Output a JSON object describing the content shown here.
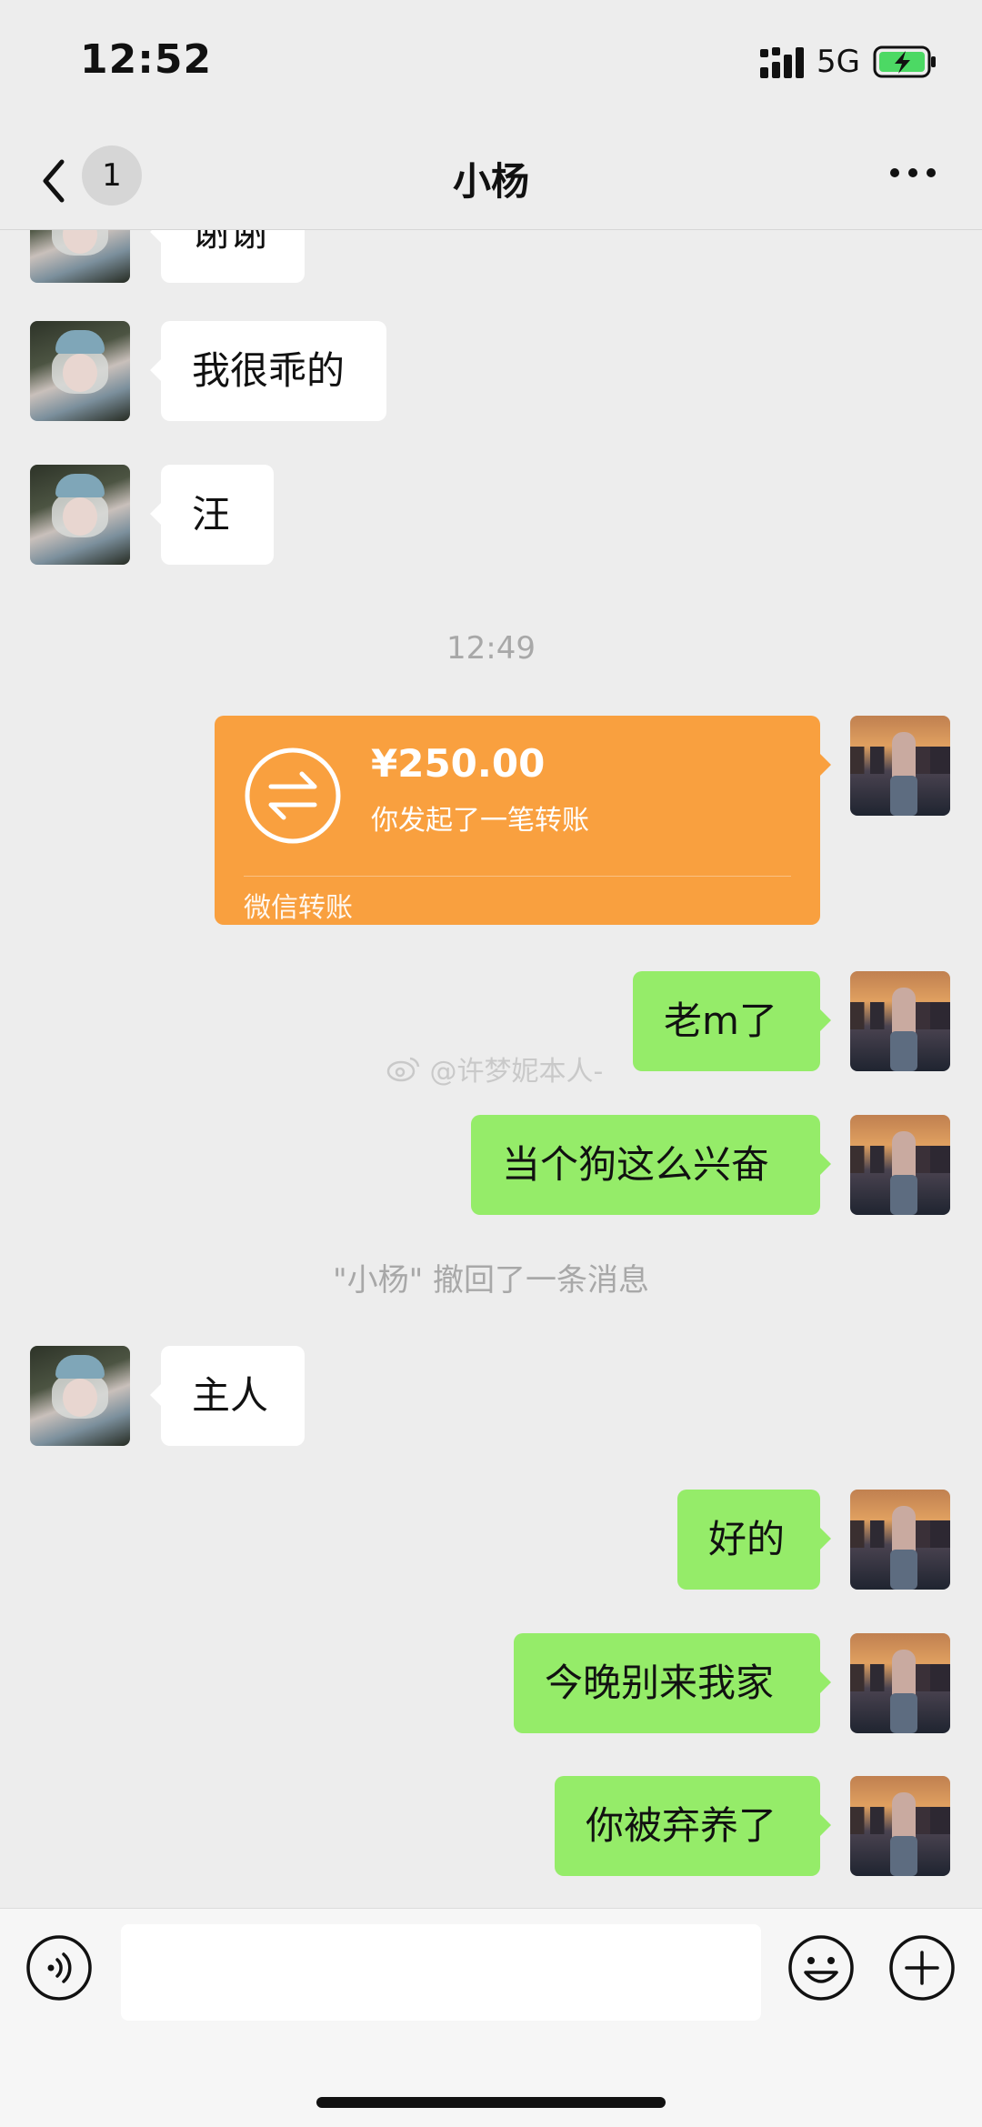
{
  "status_bar": {
    "time": "12:52",
    "network": "5G",
    "battery_color": "#4cd964"
  },
  "nav": {
    "unread_count": "1",
    "title": "小杨"
  },
  "chat": {
    "partial_message": "谢谢",
    "in_messages": [
      "我很乖的",
      "汪"
    ],
    "timestamp": "12:49",
    "transfer": {
      "amount": "¥250.00",
      "description": "你发起了一笔转账",
      "brand": "微信转账",
      "color": "#f9a03f"
    },
    "out_messages_1": [
      "老m了",
      "当个狗这么兴奋"
    ],
    "watermark": "@许梦妮本人-",
    "recall_notice": "\"小杨\" 撤回了一条消息",
    "in_messages_2": [
      "主人"
    ],
    "out_messages_2": [
      "好的",
      "今晚别来我家",
      "你被弃养了"
    ],
    "bubble_out_color": "#95ec69"
  },
  "input": {
    "value": ""
  }
}
